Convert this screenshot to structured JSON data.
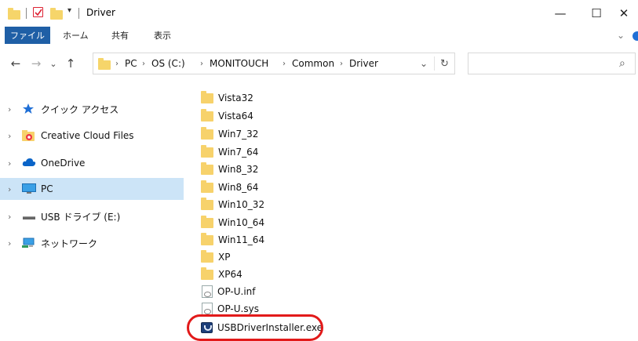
{
  "window": {
    "title": "Driver",
    "minimize": "—",
    "maximize": "☐",
    "close": "✕"
  },
  "ribbon": {
    "tabs": [
      "ファイル",
      "ホーム",
      "共有",
      "表示"
    ],
    "expand": "⌄"
  },
  "address": {
    "back": "←",
    "forward": "→",
    "recent": "⌄",
    "up": "↑",
    "crumbs": [
      "PC",
      "OS (C:)",
      "MONITOUCH",
      "Common",
      "Driver"
    ],
    "dropdown": "⌄",
    "refresh": "↻",
    "search_value": "",
    "search_icon": "⌕"
  },
  "nav": {
    "items": [
      {
        "label": "クイック アクセス",
        "icon": "star-icon"
      },
      {
        "label": "Creative Cloud Files",
        "icon": "creative-cloud-folder-icon"
      },
      {
        "label": "OneDrive",
        "icon": "cloud-icon"
      },
      {
        "label": "PC",
        "icon": "monitor-icon",
        "selected": true
      },
      {
        "label": "USB ドライブ (E:)",
        "icon": "usb-drive-icon"
      },
      {
        "label": "ネットワーク",
        "icon": "network-icon"
      }
    ]
  },
  "files": [
    {
      "name": "Vista32",
      "type": "folder"
    },
    {
      "name": "Vista64",
      "type": "folder"
    },
    {
      "name": "Win7_32",
      "type": "folder"
    },
    {
      "name": "Win7_64",
      "type": "folder"
    },
    {
      "name": "Win8_32",
      "type": "folder"
    },
    {
      "name": "Win8_64",
      "type": "folder"
    },
    {
      "name": "Win10_32",
      "type": "folder"
    },
    {
      "name": "Win10_64",
      "type": "folder"
    },
    {
      "name": "Win11_64",
      "type": "folder"
    },
    {
      "name": "XP",
      "type": "folder"
    },
    {
      "name": "XP64",
      "type": "folder"
    },
    {
      "name": "OP-U.inf",
      "type": "inf"
    },
    {
      "name": "OP-U.sys",
      "type": "sys"
    },
    {
      "name": "USBDriverInstaller.exe",
      "type": "exe"
    }
  ],
  "colors": {
    "accent": "#1f5fa6",
    "selection": "#cce4f7",
    "highlight": "#e21a1a",
    "folder": "#f7d26b"
  }
}
